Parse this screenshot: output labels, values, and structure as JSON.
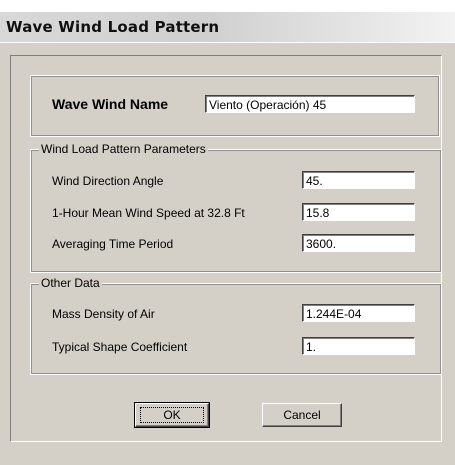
{
  "window": {
    "title": "Wave Wind Load Pattern"
  },
  "name_section": {
    "label": "Wave Wind Name",
    "value": "Viento (Operación) 45"
  },
  "wind_params": {
    "title": "Wind Load Pattern Parameters",
    "rows": [
      {
        "label": "Wind Direction Angle",
        "value": "45."
      },
      {
        "label": "1-Hour Mean Wind Speed at 32.8 Ft",
        "value": "15.8"
      },
      {
        "label": "Averaging Time Period",
        "value": "3600."
      }
    ]
  },
  "other_data": {
    "title": "Other Data",
    "rows": [
      {
        "label": "Mass Density of Air",
        "value": "1.244E-04"
      },
      {
        "label": "Typical Shape Coefficient",
        "value": "1."
      }
    ]
  },
  "buttons": {
    "ok": "OK",
    "cancel": "Cancel"
  }
}
